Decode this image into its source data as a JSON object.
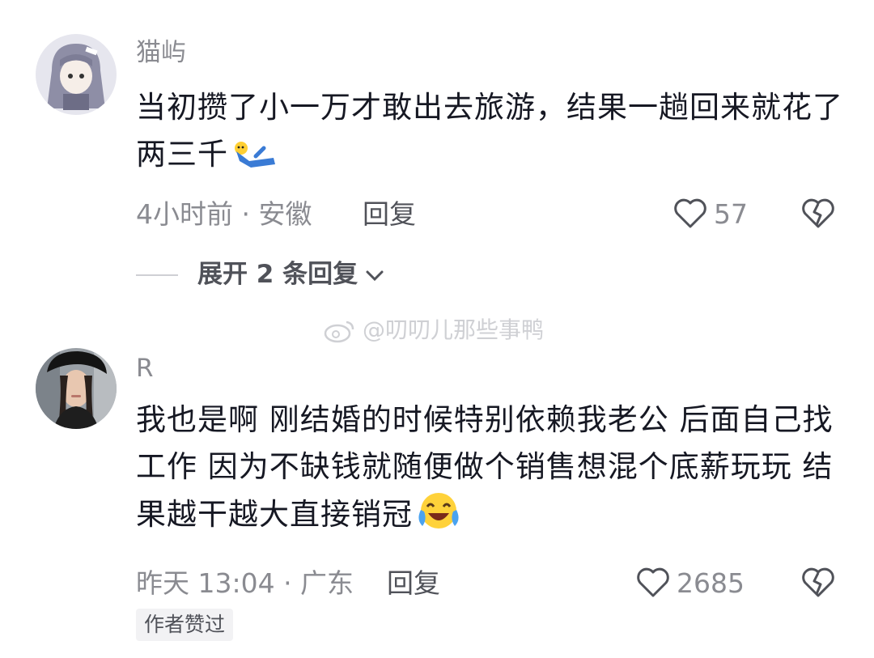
{
  "comments": [
    {
      "username": "猫屿",
      "text": "当初攒了小一万才敢出去旅游，结果一趟回来就花了两三千",
      "emoji": "lying-down-emoji",
      "meta": "4小时前 · 安徽",
      "reply_label": "回复",
      "likes": "57"
    },
    {
      "username": "R",
      "text": "我也是啊 刚结婚的时候特别依赖我老公 后面自己找工作 因为不缺钱就随便做个销售想混个底薪玩玩 结果越干越大直接销冠",
      "emoji": "crying-laughing-emoji",
      "meta": "昨天 13:04 · 广东",
      "reply_label": "回复",
      "likes": "2685",
      "badge": "作者赞过"
    }
  ],
  "expand_replies": "展开 2 条回复",
  "watermark": "@叨叨儿那些事鸭",
  "colors": {
    "text": "#161823",
    "secondary": "#8a8b91",
    "reply": "#505259"
  }
}
